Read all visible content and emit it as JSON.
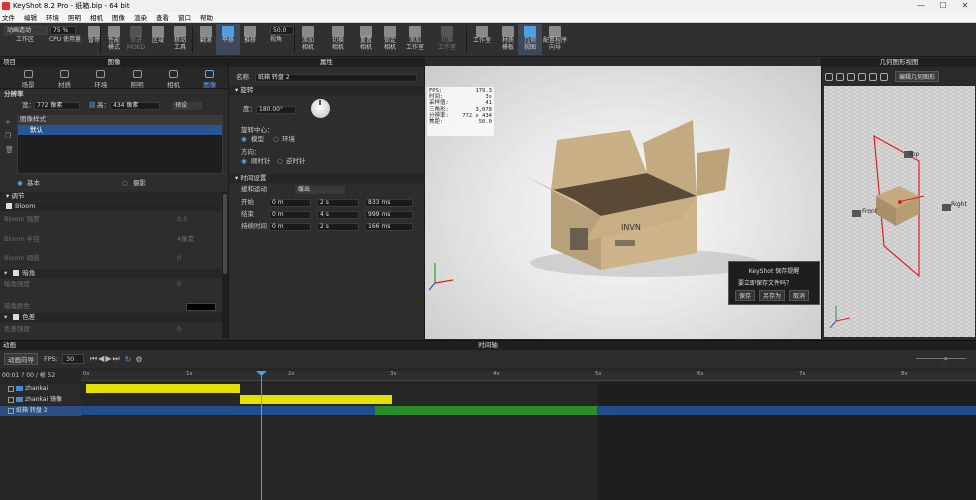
{
  "window": {
    "title": "KeyShot 8.2 Pro - 纸箱.bip - 64 bit",
    "min": "—",
    "max": "☐",
    "close": "✕"
  },
  "menu": [
    "文件",
    "编辑",
    "环境",
    "照明",
    "相机",
    "图像",
    "渲染",
    "查看",
    "窗口",
    "帮助"
  ],
  "toolbar": {
    "anim_wizard": "动画造动",
    "zoom": "75 %",
    "cpu_label": "CPU 使用量",
    "focal": "50.0",
    "buttons": [
      "工作区",
      "暂停",
      "性能\n模式",
      "渐进\nMOED",
      "区域",
      "移动\n工具",
      "翻滚",
      "平移",
      "推移",
      "视角",
      "添加\n相机",
      "切换\n相机",
      "重置\n相机",
      "锁定\n相机",
      "添加\n工作室",
      "切换\n工作室",
      "工作室",
      "材质\n模板",
      "几何\n视图",
      "配置程序\n向导"
    ]
  },
  "left_panel": {
    "header": "项目",
    "title": "图像",
    "tabs": [
      "场景",
      "材质",
      "环境",
      "照明",
      "相机",
      "图像"
    ],
    "resolution": "分辨率",
    "width_label": "宽：",
    "width_value": "772 像素",
    "height_label": "高：",
    "height_value": "434 像素",
    "preset": "预设",
    "image_style_header": "图像样式",
    "style_item": "默认",
    "mode_basic": "基本",
    "mode_photo": "摄影",
    "adjust": "调节",
    "bloom": "Bloom",
    "bloom_rows": [
      {
        "label": "Bloom 强度",
        "value": "0.5"
      },
      {
        "label": "Bloom 半径",
        "value": "4像素"
      },
      {
        "label": "Bloom 阈值",
        "value": "0"
      }
    ],
    "vignette": "暗角",
    "vignette_rows": [
      {
        "label": "暗角强度",
        "value": "0"
      },
      {
        "label": "暗角颜色",
        "value": ""
      }
    ],
    "chroma": "色差",
    "chroma_rows": [
      {
        "label": "色差强度",
        "value": "0"
      }
    ]
  },
  "mid_panel": {
    "title": "属性",
    "name_label": "名称",
    "name_value": "纸箱 转盘 2",
    "rotation": "旋转",
    "degree_label": "度：",
    "degree_value": "180.00°",
    "center_label": "旋转中心：",
    "center_model": "模型",
    "center_env": "环境",
    "direction_label": "方向：",
    "dir_cw": "顺时针",
    "dir_ccw": "逆时针",
    "timing": "时间设置",
    "ease_label": "缓和运动",
    "ease_value": "缓出",
    "timing_rows": [
      {
        "label": "开始",
        "a": "0 m",
        "b": "2 s",
        "c": "833 ms"
      },
      {
        "label": "结束",
        "a": "0 m",
        "b": "4 s",
        "c": "999 ms"
      },
      {
        "label": "持续时间",
        "a": "0 m",
        "b": "2 s",
        "c": "166 ms"
      }
    ]
  },
  "stats": [
    {
      "k": "FPS:",
      "v": "179.3"
    },
    {
      "k": "时间:",
      "v": "3s"
    },
    {
      "k": "采样值:",
      "v": "41"
    },
    {
      "k": "三角形:",
      "v": "3,078"
    },
    {
      "k": "分辨率:",
      "v": "772 x 434"
    },
    {
      "k": "焦距:",
      "v": "50.0"
    }
  ],
  "dialog": {
    "title": "KeyShot 保存提醒",
    "message": "要立即保存文件吗？",
    "save": "保存",
    "save_as": "另存为",
    "cancel": "取消"
  },
  "geo": {
    "title": "几何图形视图",
    "dropdown": "编辑几何图形",
    "labels": [
      "Top",
      "Front",
      "Right"
    ]
  },
  "timeline": {
    "header_left": "动画",
    "title": "时间轴",
    "wizard": "动画向导",
    "fps_label": "FPS:",
    "fps_value": "30",
    "time_readout": "00:01 ? 00 / 帧 52",
    "ticks": [
      "0s",
      "1s",
      "2s",
      "3s",
      "4s",
      "5s",
      "6s",
      "7s",
      "8s"
    ],
    "tracks": [
      "zhankai",
      "zhankai 镜像",
      "纸箱 转盘 2"
    ]
  },
  "colors": {
    "accent": "#4f9fe0",
    "yellow": "#e3e000",
    "blue": "#1f4e8c",
    "green": "#2a8f2a",
    "red": "#e02020"
  }
}
